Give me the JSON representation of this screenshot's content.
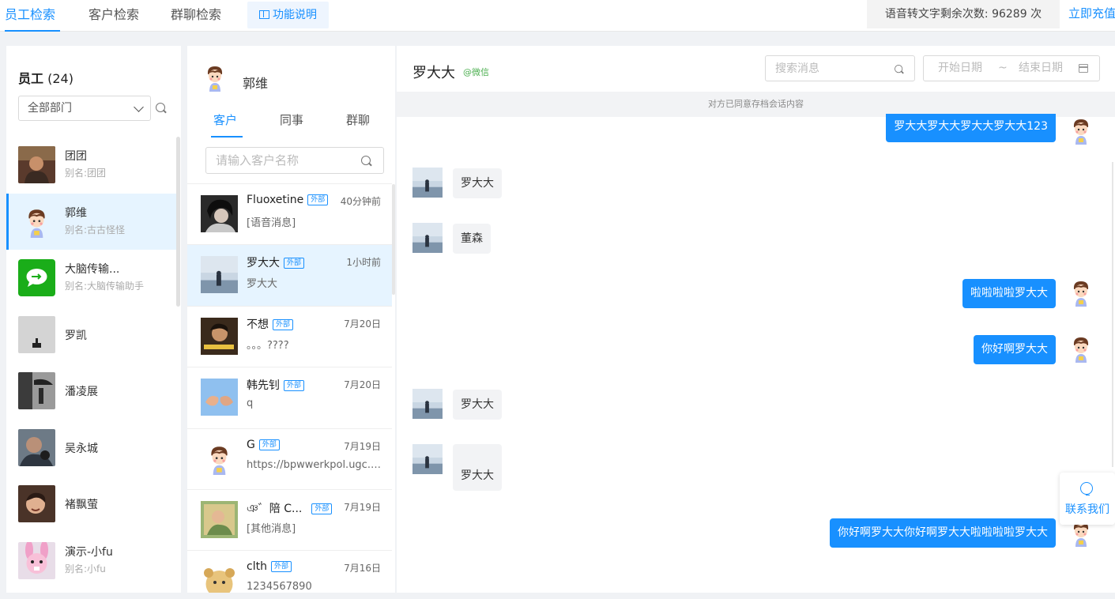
{
  "top_tabs": [
    {
      "label": "员工检索",
      "active": true
    },
    {
      "label": "客户检索",
      "active": false
    },
    {
      "label": "群聊检索",
      "active": false
    }
  ],
  "help_button": {
    "label": "功能说明",
    "icon": "book-icon"
  },
  "quota": {
    "label": "语音转文字剩余次数:",
    "count": "96289",
    "unit": "次"
  },
  "recharge_label": "立即充值",
  "employee_panel": {
    "title": "员工",
    "count": "(24)",
    "department_select": "全部部门",
    "items": [
      {
        "name": "团团",
        "alias": "别名:团团"
      },
      {
        "name": "郭维",
        "alias": "别名:古古怪怪"
      },
      {
        "name": "大脑传输...",
        "alias": "别名:大脑传输助手"
      },
      {
        "name": "罗凯",
        "alias": ""
      },
      {
        "name": "潘凌展",
        "alias": ""
      },
      {
        "name": "吴永城",
        "alias": ""
      },
      {
        "name": "褚飘萤",
        "alias": ""
      },
      {
        "name": "演示-小fu",
        "alias": "别名:小fu"
      }
    ]
  },
  "customer_panel": {
    "header_name": "郭维",
    "tabs": [
      "客户",
      "同事",
      "群聊"
    ],
    "search_placeholder": "请输入客户名称",
    "items": [
      {
        "name": "Fluoxetine",
        "badge": "外部",
        "time": "40分钟前",
        "msg": "[语音消息]"
      },
      {
        "name": "罗大大",
        "badge": "外部",
        "time": "1小时前",
        "msg": "罗大大"
      },
      {
        "name": "不想",
        "badge": "外部",
        "time": "7月20日",
        "msg": "。。。????"
      },
      {
        "name": "韩先钊",
        "badge": "外部",
        "time": "7月20日",
        "msg": "q"
      },
      {
        "name": "G",
        "badge": "外部",
        "time": "7月19日",
        "msg": "https://bpwwerkpol.ugc.w..."
      },
      {
        "name": "ঞ゛陪 𝖢...",
        "badge": "外部",
        "time": "7月19日",
        "msg": "[其他消息]"
      },
      {
        "name": "clth",
        "badge": "外部",
        "time": "7月16日",
        "msg": "1234567890"
      }
    ]
  },
  "chat": {
    "title": "罗大大",
    "source_tag": "@微信",
    "search_placeholder": "搜索消息",
    "date_start": "开始日期",
    "date_sep": "~",
    "date_end": "结束日期",
    "consent_notice": "对方已同意存档会话内容",
    "messages": [
      {
        "side": "right",
        "text": "罗大大罗大大罗大大罗大大123"
      },
      {
        "side": "left",
        "text": "罗大大"
      },
      {
        "side": "left",
        "text": "董森"
      },
      {
        "side": "right",
        "text": "啦啦啦啦罗大大"
      },
      {
        "side": "right",
        "text": "你好啊罗大大"
      },
      {
        "side": "left",
        "text": "罗大大"
      },
      {
        "side": "left",
        "text": "罗大大"
      },
      {
        "side": "right",
        "text": "你好啊罗大大你好啊罗大大啦啦啦啦罗大大"
      }
    ]
  },
  "contact_us": "联系我们",
  "colors": {
    "accent": "#1890ff",
    "wechat_tag": "#4caf50",
    "active_row": "#e6f4ff"
  }
}
